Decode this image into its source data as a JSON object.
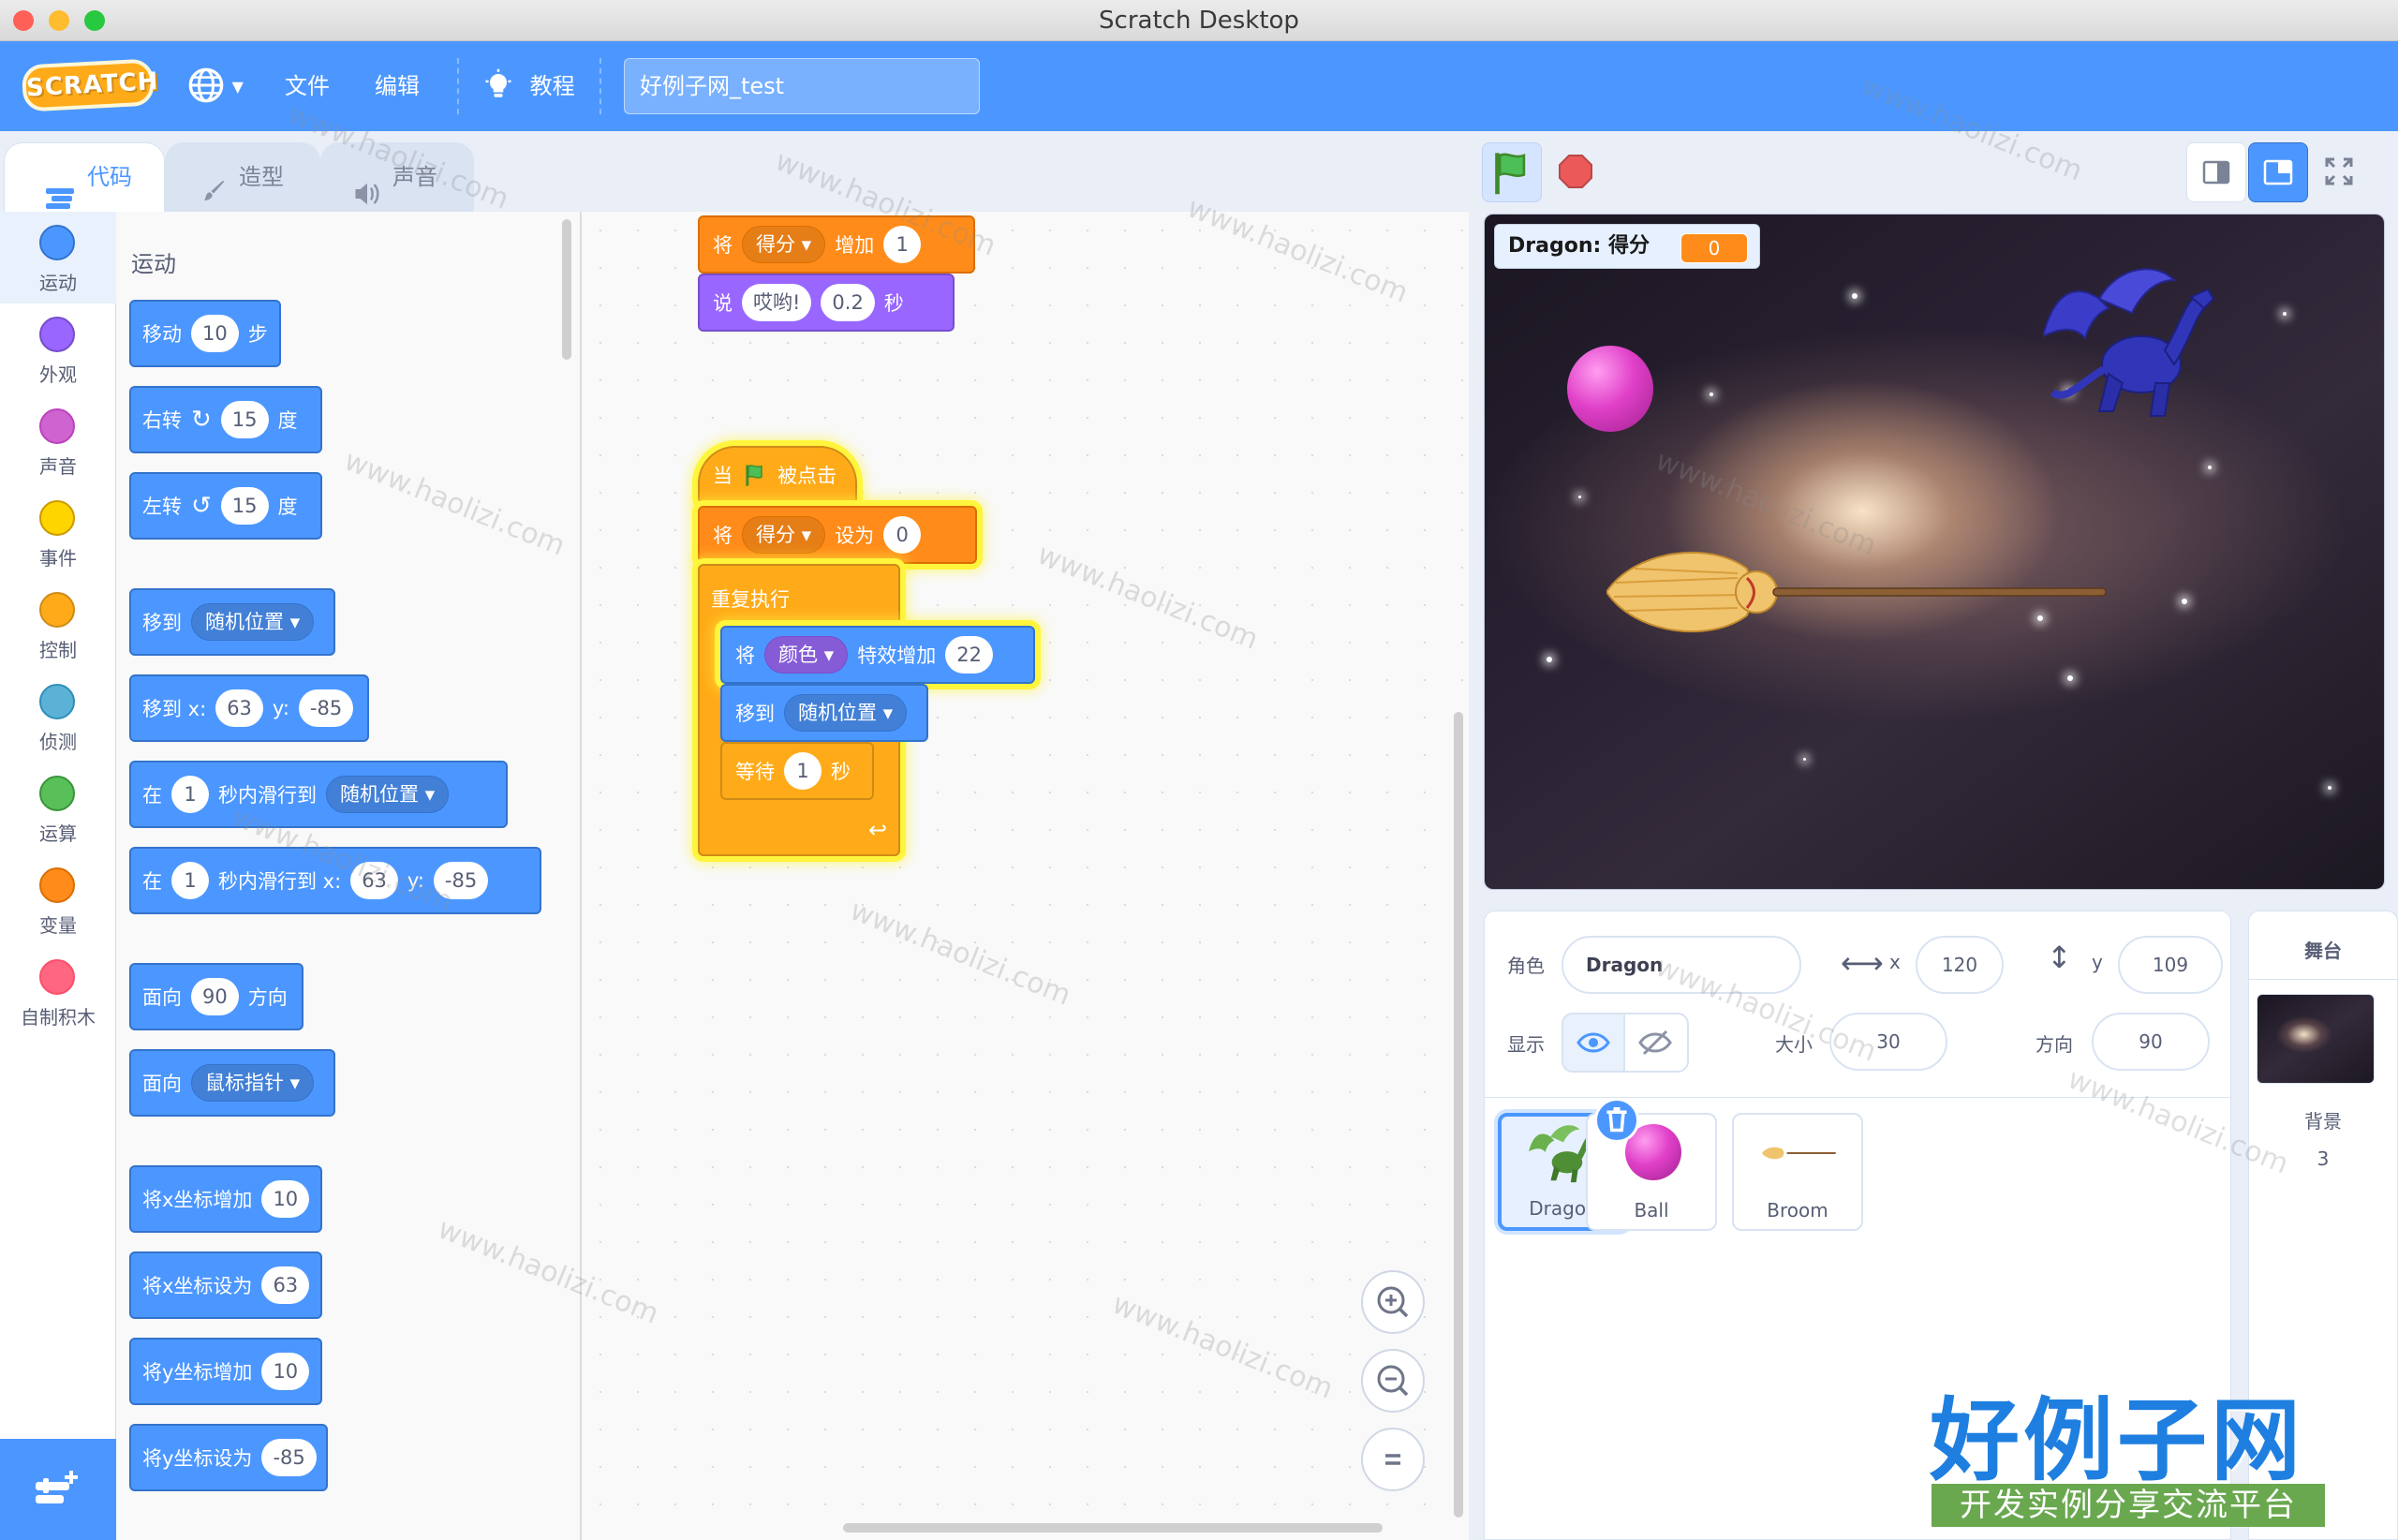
{
  "window": {
    "title": "Scratch Desktop"
  },
  "menubar": {
    "logo": "SCRATCH",
    "file": "文件",
    "edit": "编辑",
    "tutorials": "教程",
    "project_title": "好例子网_test"
  },
  "tabs": {
    "code": "代码",
    "costumes": "造型",
    "sounds": "声音"
  },
  "categories": [
    {
      "label": "运动",
      "color": "#4c97ff"
    },
    {
      "label": "外观",
      "color": "#9966ff"
    },
    {
      "label": "声音",
      "color": "#cf63cf"
    },
    {
      "label": "事件",
      "color": "#ffd500"
    },
    {
      "label": "控制",
      "color": "#ffab19"
    },
    {
      "label": "侦测",
      "color": "#5cb1d6"
    },
    {
      "label": "运算",
      "color": "#59c059"
    },
    {
      "label": "变量",
      "color": "#ff8c1a"
    },
    {
      "label": "自制积木",
      "color": "#ff6680"
    }
  ],
  "palette": {
    "heading": "运动",
    "move": {
      "a": "移动",
      "v": "10",
      "b": "步"
    },
    "turn_right": {
      "a": "右转",
      "v": "15",
      "b": "度"
    },
    "turn_left": {
      "a": "左转",
      "v": "15",
      "b": "度"
    },
    "goto": {
      "a": "移到",
      "dd": "随机位置"
    },
    "goto_xy": {
      "a": "移到 x:",
      "x": "63",
      "b": "y:",
      "y": "-85"
    },
    "glide_to": {
      "a": "在",
      "v": "1",
      "b": "秒内滑行到",
      "dd": "随机位置"
    },
    "glide_xy": {
      "a": "在",
      "v": "1",
      "b": "秒内滑行到 x:",
      "x": "63",
      "c": "y:",
      "y": "-85"
    },
    "point_dir": {
      "a": "面向",
      "v": "90",
      "b": "方向"
    },
    "point_towards": {
      "a": "面向",
      "dd": "鼠标指针"
    },
    "change_x": {
      "a": "将x坐标增加",
      "v": "10"
    },
    "set_x": {
      "a": "将x坐标设为",
      "v": "63"
    },
    "change_y": {
      "a": "将y坐标增加",
      "v": "10"
    },
    "set_y": {
      "a": "将y坐标设为",
      "v": "-85"
    }
  },
  "script_top": {
    "change_var": {
      "a": "将",
      "dd": "得分",
      "b": "增加",
      "v": "1"
    },
    "say": {
      "a": "说",
      "msg": "哎哟!",
      "secs": "0.2",
      "b": "秒"
    }
  },
  "script_main": {
    "hat": {
      "a": "当",
      "b": "被点击"
    },
    "set_var": {
      "a": "将",
      "dd": "得分",
      "b": "设为",
      "v": "0"
    },
    "forever": "重复执行",
    "effect": {
      "a": "将",
      "dd": "颜色",
      "b": "特效增加",
      "v": "22"
    },
    "goto": {
      "a": "移到",
      "dd": "随机位置"
    },
    "wait": {
      "a": "等待",
      "v": "1",
      "b": "秒"
    }
  },
  "stage": {
    "monitor_label": "Dragon: 得分",
    "monitor_value": "0"
  },
  "sprite_info": {
    "sprite_label": "角色",
    "sprite_name": "Dragon",
    "x_label": "x",
    "x": "120",
    "y_label": "y",
    "y": "109",
    "show_label": "显示",
    "size_label": "大小",
    "size": "30",
    "direction_label": "方向",
    "direction": "90"
  },
  "sprites": [
    {
      "name": "Dragon",
      "selected": true
    },
    {
      "name": "Ball",
      "selected": false
    },
    {
      "name": "Broom",
      "selected": false
    }
  ],
  "stage_pane": {
    "title": "舞台",
    "backdrops_label": "背景",
    "backdrops_count": "3"
  },
  "watermark": {
    "text": "www.haolizi.com",
    "brand": "好例子网",
    "brand_sub": "开发实例分享交流平台"
  }
}
